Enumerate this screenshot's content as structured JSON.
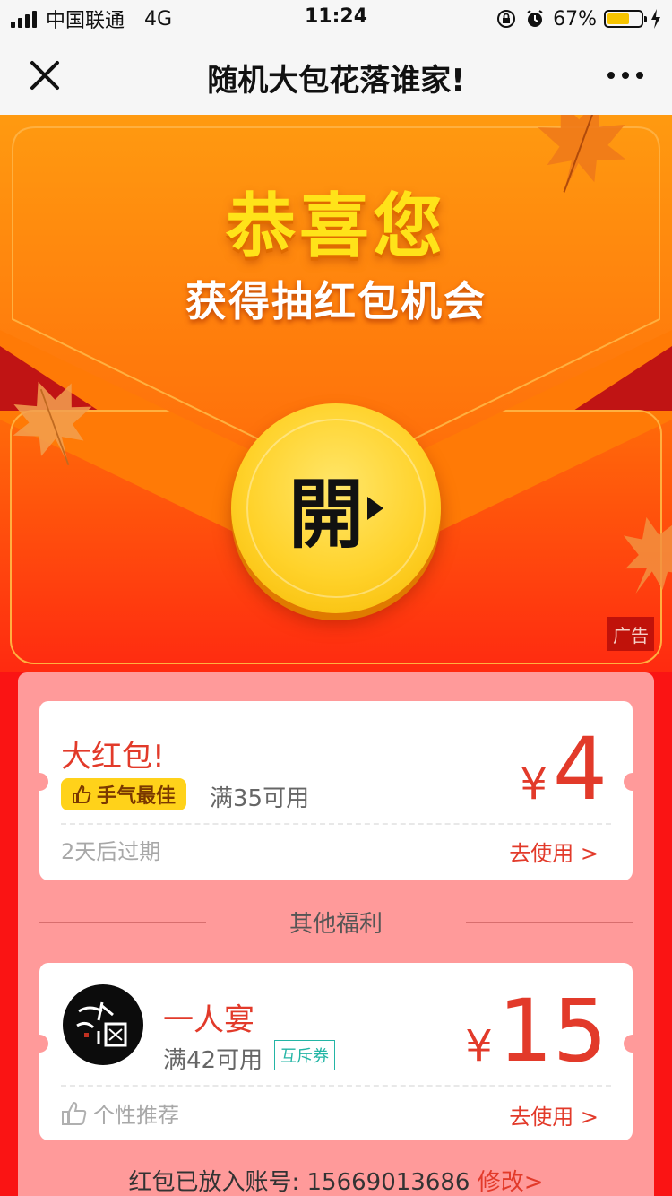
{
  "status_bar": {
    "carrier": "中国联通",
    "network": "4G",
    "time": "11:24",
    "battery": "67%",
    "battery_level": 0.67
  },
  "nav": {
    "title": "随机大包花落谁家!",
    "close_icon": "close-icon",
    "more_icon": "more-icon"
  },
  "envelope": {
    "headline": "恭喜您",
    "subtitle": "获得抽红包机会",
    "open_button": "開",
    "ad_label": "广告"
  },
  "card_main": {
    "title": "大红包!",
    "badge": "手气最佳",
    "condition": "满35可用",
    "currency": "¥",
    "amount": "4",
    "expire": "2天后过期",
    "use_link": "去使用 >"
  },
  "section_other": "其他福利",
  "card_other": {
    "name": "一人宴",
    "condition": "满42可用",
    "tag": "互斥券",
    "currency": "¥",
    "amount": "15",
    "recommend": "个性推荐",
    "use_link": "去使用 >"
  },
  "account": {
    "prefix": "红包已放入账号: ",
    "number": "15669013686",
    "edit": "修改>"
  },
  "colors": {
    "accent_red": "#e23a2a",
    "gold": "#ffd21a",
    "panel_pink": "#ff9a9a",
    "exclusive_tag": "#23b5a5"
  }
}
